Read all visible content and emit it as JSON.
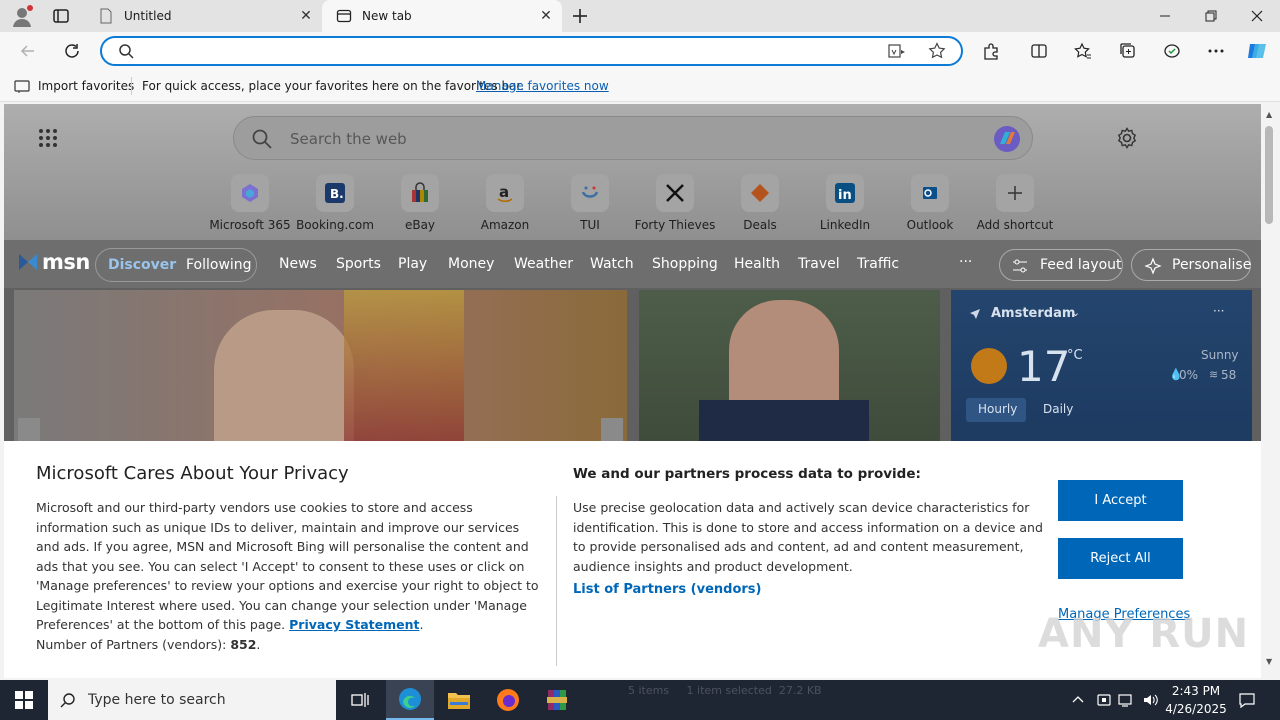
{
  "tabs": [
    {
      "label": "Untitled"
    },
    {
      "label": "New tab"
    }
  ],
  "address": {
    "value": ""
  },
  "favorites_bar": {
    "import_label": "Import favorites",
    "hint": "For quick access, place your favorites here on the favorites bar.",
    "manage_link": "Manage favorites now"
  },
  "search": {
    "placeholder": "Search the web"
  },
  "shortcuts": [
    {
      "label": "Microsoft 365"
    },
    {
      "label": "Booking.com"
    },
    {
      "label": "eBay"
    },
    {
      "label": "Amazon"
    },
    {
      "label": "TUI"
    },
    {
      "label": "Forty Thieves"
    },
    {
      "label": "Deals"
    },
    {
      "label": "LinkedIn"
    },
    {
      "label": "Outlook"
    },
    {
      "label": "Add shortcut"
    }
  ],
  "msn": {
    "logo": "msn",
    "tabs": [
      "Discover",
      "Following"
    ],
    "nav": [
      "News",
      "Sports",
      "Play",
      "Money",
      "Weather",
      "Watch",
      "Shopping",
      "Health",
      "Travel",
      "Traffic"
    ],
    "more": "···",
    "feed_layout": "Feed layout",
    "personalise": "Personalise"
  },
  "weather": {
    "location": "Amsterdam",
    "temp": "17",
    "unit": "°C",
    "condition": "Sunny",
    "precip": "0%",
    "wind": "58",
    "tabs": [
      "Hourly",
      "Daily"
    ]
  },
  "privacy": {
    "title": "Microsoft Cares About Your Privacy",
    "body": "Microsoft and our third-party vendors use cookies to store and access information such as unique IDs to deliver, maintain and improve our services and ads. If you agree, MSN and Microsoft Bing will personalise the content and ads that you see. You can select 'I Accept' to consent to these uses or click on 'Manage preferences' to review your options and exercise your right to object to Legitimate Interest where used.  You can change your selection under 'Manage Preferences' at the bottom of this page.",
    "privacy_link": "Privacy Statement",
    "partners_count_label": "Number of Partners (vendors):",
    "partners_count": "852",
    "partners_title": "We and our partners process data to provide:",
    "partners_body": "Use precise geolocation data and actively scan device characteristics for identification. This is done to store and access information on a device and to provide personalised ads and content, ad and content measurement, audience insights and product development.",
    "partners_link": "List of Partners (vendors)",
    "accept": "I Accept",
    "reject": "Reject All",
    "manage": "Manage Preferences"
  },
  "taskbar": {
    "search_placeholder": "Type here to search",
    "explorer_status": "5 items     1 item selected  27.2 KB",
    "time": "2:43 PM",
    "date": "4/26/2025"
  },
  "watermark": "ANY RUN",
  "colors": {
    "accent": "#0067b8",
    "address_border": "#0a7bd6",
    "taskbar": "#1f2633"
  }
}
